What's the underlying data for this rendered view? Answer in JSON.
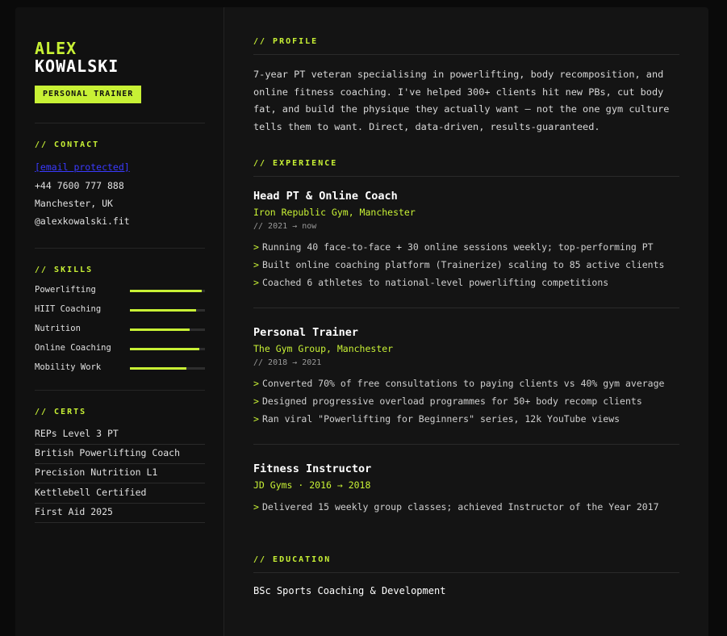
{
  "name": {
    "first": "ALEX",
    "last": "KOWALSKI"
  },
  "role": "PERSONAL TRAINER",
  "sidebar": {
    "contact_title": "// CONTACT",
    "contact": {
      "email": "[email protected]",
      "phone": "+44 7600 777 888",
      "location": "Manchester, UK",
      "handle": "@alexkowalski.fit"
    },
    "skills_title": "// SKILLS",
    "skills": [
      {
        "label": "Powerlifting",
        "level": 0.96
      },
      {
        "label": "HIIT Coaching",
        "level": 0.88
      },
      {
        "label": "Nutrition",
        "level": 0.8
      },
      {
        "label": "Online Coaching",
        "level": 0.92
      },
      {
        "label": "Mobility Work",
        "level": 0.75
      }
    ],
    "certs_title": "// CERTS",
    "certs": [
      "REPs Level 3 PT",
      "British Powerlifting Coach",
      "Precision Nutrition L1",
      "Kettlebell Certified",
      "First Aid 2025"
    ]
  },
  "main": {
    "profile_title": "// PROFILE",
    "profile_text": "7-year PT veteran specialising in powerlifting, body recomposition, and online fitness coaching. I've helped 300+ clients hit new PBs, cut body fat, and build the physique they actually want — not the one gym culture tells them to want. Direct, data-driven, results-guaranteed.",
    "experience_title": "// EXPERIENCE",
    "jobs": [
      {
        "title": "Head PT & Online Coach",
        "company": "Iron Republic Gym, Manchester",
        "dates": "// 2021 → now",
        "bullets": [
          "Running 40 face-to-face + 30 online sessions weekly; top-performing PT",
          "Built online coaching platform (Trainerize) scaling to 85 active clients",
          "Coached 6 athletes to national-level powerlifting competitions"
        ]
      },
      {
        "title": "Personal Trainer",
        "company": "The Gym Group, Manchester",
        "dates": "// 2018 → 2021",
        "bullets": [
          "Converted 70% of free consultations to paying clients vs 40% gym average",
          "Designed progressive overload programmes for 50+ body recomp clients",
          "Ran viral \"Powerlifting for Beginners\" series, 12k YouTube views"
        ]
      },
      {
        "title": "Fitness Instructor",
        "company": "JD Gyms · 2016 → 2018",
        "bullets": [
          "Delivered 15 weekly group classes; achieved Instructor of the Year 2017"
        ]
      }
    ],
    "education_title": "// EDUCATION",
    "education": "BSc Sports Coaching & Development"
  },
  "colors": {
    "accent": "#c8f135",
    "background": "#141414",
    "sidebar": "#111111"
  }
}
